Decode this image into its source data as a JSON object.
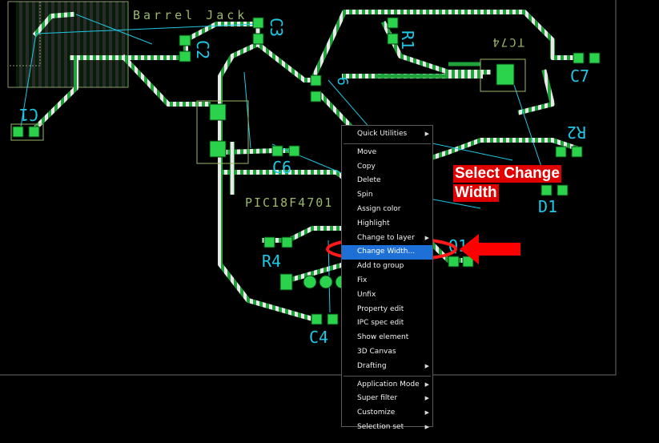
{
  "board": {
    "labels": {
      "barrel_jack": "Barrel Jack",
      "c1": "C1",
      "c2": "C2",
      "c3": "C3",
      "c4": "C4",
      "c6": "C6",
      "c7": "C7",
      "r1": "R1",
      "r2": "R2",
      "r4": "R4",
      "q1": "Q1",
      "d1": "D1",
      "tc74": "TC74",
      "pic": "PIC18F4701"
    },
    "colors": {
      "background": "#000000",
      "trace_green": "#1fa33a",
      "trace_white": "#ffffff",
      "pad_green": "#2bd24b",
      "silkscreen": "#9db86b",
      "ratsnest": "#1ec8e6",
      "outline": "#7a7a7a"
    }
  },
  "context_menu": {
    "items": [
      {
        "label": "Quick Utilities",
        "submenu": true
      },
      {
        "label": "Move"
      },
      {
        "label": "Copy"
      },
      {
        "label": "Delete"
      },
      {
        "label": "Spin"
      },
      {
        "label": "Assign color"
      },
      {
        "label": "Highlight"
      },
      {
        "label": "Change to layer",
        "submenu": true
      },
      {
        "label": "Change Width...",
        "highlighted": true
      },
      {
        "label": "Add to group"
      },
      {
        "label": "Fix"
      },
      {
        "label": "Unfix"
      },
      {
        "label": "Property edit"
      },
      {
        "label": "IPC spec edit"
      },
      {
        "label": "Show element"
      },
      {
        "label": "3D Canvas"
      },
      {
        "label": "Drafting",
        "submenu": true
      },
      {
        "label": "Application Mode",
        "submenu": true
      },
      {
        "label": "Super filter",
        "submenu": true
      },
      {
        "label": "Customize",
        "submenu": true
      },
      {
        "label": "Selection set",
        "submenu": true
      }
    ],
    "highlight_color": "#1e6fd6"
  },
  "annotation": {
    "line1": "Select Change",
    "line2": "Width",
    "color": "#e00000"
  }
}
